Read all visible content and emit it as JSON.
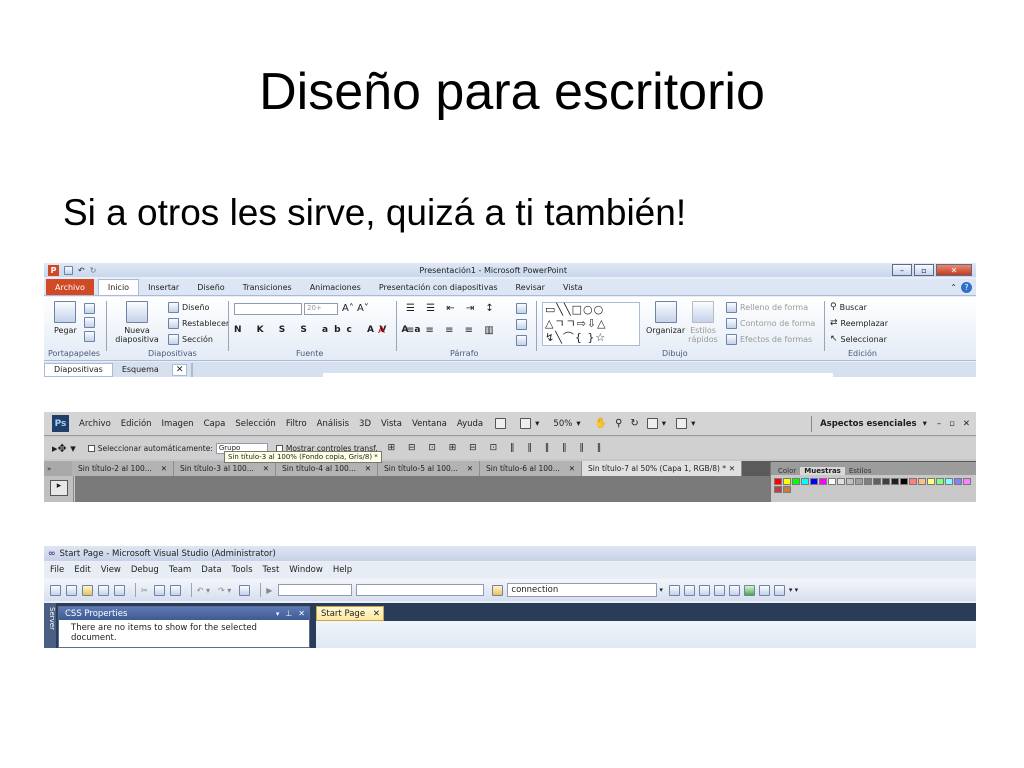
{
  "slide": {
    "title": "Diseño para escritorio",
    "subtitle": "Si a otros les sirve, quizá a ti también!"
  },
  "powerpoint": {
    "window_title": "Presentación1 - Microsoft PowerPoint",
    "tabs": [
      "Archivo",
      "Inicio",
      "Insertar",
      "Diseño",
      "Transiciones",
      "Animaciones",
      "Presentación con diapositivas",
      "Revisar",
      "Vista"
    ],
    "pegar": "Pegar",
    "nueva_diapositiva": "Nueva diapositiva",
    "diseno": "Diseño",
    "restablecer": "Restablecer",
    "seccion": "Sección",
    "font_size": "20+",
    "organizar": "Organizar",
    "estilos_rapidos": "Estilos rápidos",
    "relleno": "Relleno de forma",
    "contorno": "Contorno de forma",
    "efectos": "Efectos de formas",
    "buscar": "Buscar",
    "reemplazar": "Reemplazar",
    "seleccionar": "Seleccionar",
    "groups": [
      "Portapapeles",
      "Diapositivas",
      "Fuente",
      "Párrafo",
      "Dibujo",
      "Edición"
    ],
    "panel_tabs": [
      "Diapositivas",
      "Esquema"
    ]
  },
  "photoshop": {
    "logo": "Ps",
    "menu": [
      "Archivo",
      "Edición",
      "Imagen",
      "Capa",
      "Selección",
      "Filtro",
      "Análisis",
      "3D",
      "Vista",
      "Ventana",
      "Ayuda"
    ],
    "zoom": "50%",
    "workspace": "Aspectos esenciales",
    "auto_select": "Seleccionar automáticamente:",
    "auto_select_value": "Grupo",
    "show_controls": "Mostrar controles transf.",
    "tooltip": "Sin título-3 al 100% (Fondo copia, Gris/8) *",
    "doc_tabs": [
      "Sin título-2 al 100...",
      "Sin título-3 al 100...",
      "Sin título-4 al 100...",
      "Sin título-5 al 100...",
      "Sin título-6 al 100...",
      "Sin título-7 al 50% (Capa 1, RGB/8) *"
    ],
    "panel_tabs": [
      "Color",
      "Muestras",
      "Estilos"
    ],
    "swatch_colors": [
      "#ff0000",
      "#ffff00",
      "#00ff00",
      "#00ffff",
      "#0000ff",
      "#ff00ff",
      "#ffffff",
      "#e0e0e0",
      "#c0c0c0",
      "#a0a0a0",
      "#808080",
      "#606060",
      "#404040",
      "#202020",
      "#000000",
      "#ff8080",
      "#ffc080",
      "#ffff80",
      "#80ff80",
      "#80ffff",
      "#8080ff",
      "#ff80ff",
      "#c04040",
      "#c08040"
    ]
  },
  "visualstudio": {
    "window_title": "Start Page - Microsoft Visual Studio (Administrator)",
    "menu": [
      "File",
      "Edit",
      "View",
      "Debug",
      "Team",
      "Data",
      "Tools",
      "Test",
      "Window",
      "Help"
    ],
    "search_value": "connection",
    "panel_title": "CSS Properties",
    "side_label": "Server",
    "panel_message": "There are no items to show for the selected document.",
    "doc_tab": "Start Page"
  }
}
